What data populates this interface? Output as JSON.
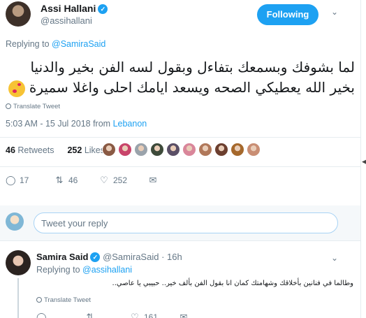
{
  "tweet": {
    "author_name": "Assi Hallani",
    "author_handle": "@assihallani",
    "follow_label": "Following",
    "replying_prefix": "Replying to",
    "replying_to": "@SamiraSaid",
    "text": "لما بشوفك وبسمعك بتفاءل وبقول لسه الفن بخير والدنيا بخير الله يعطيكي الصحه ويسعد ايامك احلى واغلا سميرة",
    "translate_label": "Translate Tweet",
    "time": "5:03 AM - 15 Jul 2018 from",
    "location": "Lebanon",
    "retweets_count": "46",
    "retweets_label": "Retweets",
    "likes_count": "252",
    "likes_label": "Likes",
    "reply_count": "17",
    "retweet_action_count": "46",
    "like_action_count": "252"
  },
  "liker_faces": [
    "#8a5a44",
    "#c8446a",
    "#9aa3ab",
    "#3d4a3a",
    "#5a4f66",
    "#d9869a",
    "#b0785a",
    "#6c3f2f",
    "#a5682c",
    "#c98e74"
  ],
  "reply_box": {
    "placeholder": "Tweet your reply"
  },
  "reply": {
    "author_name": "Samira Said",
    "author_handle": "@SamiraSaid",
    "time": "· 16h",
    "replying_prefix": "Replying to",
    "replying_to": "@assihallani",
    "text": "وطالما في فنانين بأخلاقك وشهامتك كمان انا بقول الفن بألف خير.. حبيبي يا عاصي..",
    "translate_label": "Translate Tweet",
    "like_count": "161"
  }
}
